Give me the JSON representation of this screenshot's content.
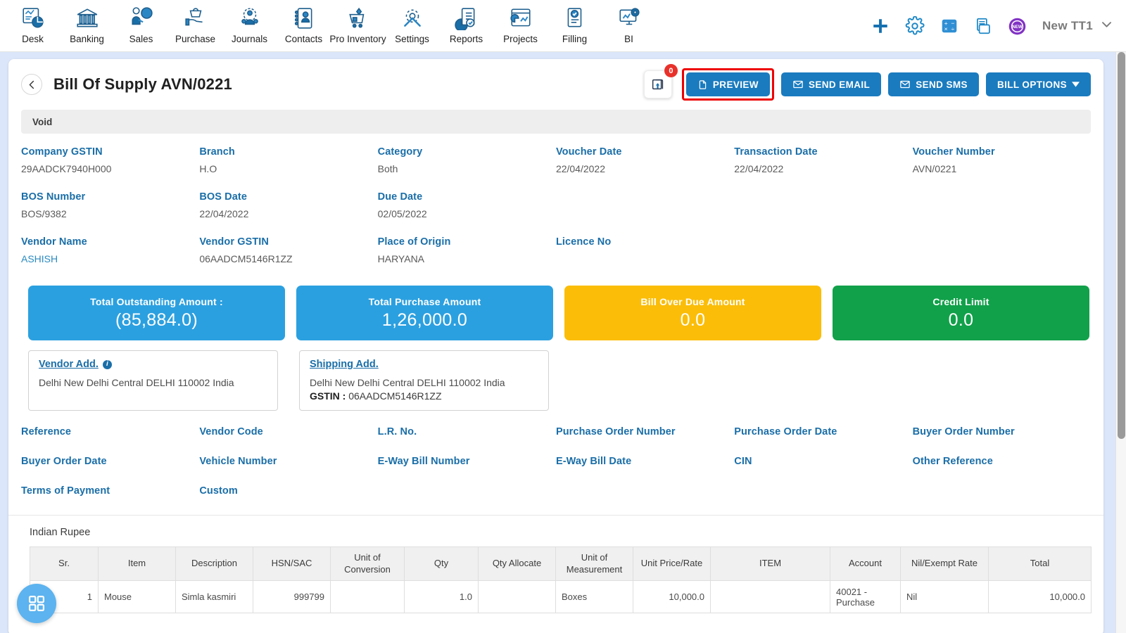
{
  "topnav": {
    "items": [
      {
        "label": "Desk",
        "icon": "dashboard-icon"
      },
      {
        "label": "Banking",
        "icon": "bank-icon"
      },
      {
        "label": "Sales",
        "icon": "sales-icon"
      },
      {
        "label": "Purchase",
        "icon": "purchase-icon"
      },
      {
        "label": "Journals",
        "icon": "journals-icon"
      },
      {
        "label": "Contacts",
        "icon": "contacts-icon"
      },
      {
        "label": "Pro Inventory",
        "icon": "inventory-icon"
      },
      {
        "label": "Settings",
        "icon": "settings-icon"
      },
      {
        "label": "Reports",
        "icon": "reports-icon"
      },
      {
        "label": "Projects",
        "icon": "projects-icon"
      },
      {
        "label": "Filling",
        "icon": "filling-icon"
      },
      {
        "label": "BI",
        "icon": "bi-icon"
      }
    ],
    "right_icons": [
      {
        "name": "add-icon"
      },
      {
        "name": "gear-icon"
      },
      {
        "name": "calculator-icon"
      },
      {
        "name": "notes-icon"
      },
      {
        "name": "new-badge-icon",
        "text": "NEW"
      }
    ],
    "user": {
      "name": "New TT1",
      "caret": "chevron-down-icon"
    }
  },
  "header": {
    "back": "back-arrow-icon",
    "title": "Bill Of Supply AVN/0221",
    "upload": {
      "icon": "upload-attachment-icon",
      "badge": "0"
    },
    "buttons": [
      {
        "label": "PREVIEW",
        "icon": "pdf-icon",
        "highlighted": true
      },
      {
        "label": "SEND EMAIL",
        "icon": "envelope-icon",
        "highlighted": false
      },
      {
        "label": "SEND SMS",
        "icon": "envelope-icon",
        "highlighted": false
      },
      {
        "label": "BILL OPTIONS",
        "icon": "caret-down-icon",
        "highlighted": false
      }
    ]
  },
  "status_bar": {
    "text": "Void"
  },
  "fields": {
    "row1_labels": [
      "Company GSTIN",
      "Branch",
      "Category",
      "Voucher Date",
      "Transaction Date",
      "Voucher Number"
    ],
    "row1_values": [
      "29AADCK7940H000",
      "H.O",
      "Both",
      "22/04/2022",
      "22/04/2022",
      "AVN/0221"
    ],
    "row2_labels": [
      "BOS Number",
      "BOS Date",
      "Due Date",
      "",
      "",
      ""
    ],
    "row2_values": [
      "BOS/9382",
      "22/04/2022",
      "02/05/2022",
      "",
      "",
      ""
    ],
    "row3_labels": [
      "Vendor Name",
      "Vendor GSTIN",
      "Place of Origin",
      "Licence No",
      "",
      ""
    ],
    "row3_values": [
      "ASHISH",
      "06AADCM5146R1ZZ",
      "HARYANA",
      "",
      "",
      ""
    ],
    "row4_labels": [
      "Reference",
      "Vendor Code",
      "L.R. No.",
      "Purchase Order Number",
      "Purchase Order Date",
      "Buyer Order Number"
    ],
    "row5_labels": [
      "Buyer Order Date",
      "Vehicle Number",
      "E-Way Bill Number",
      "E-Way Bill Date",
      "CIN",
      "Other Reference"
    ],
    "row6_labels": [
      "Terms of Payment",
      "Custom",
      "",
      "",
      "",
      ""
    ]
  },
  "stats": [
    {
      "title": "Total Outstanding Amount :",
      "value": "(85,884.0)",
      "color": "#2ba0e0"
    },
    {
      "title": "Total Purchase Amount",
      "value": "1,26,000.0",
      "color": "#2ba0e0"
    },
    {
      "title": "Bill Over Due Amount",
      "value": "0.0",
      "color": "#fbbd08"
    },
    {
      "title": "Credit Limit",
      "value": "0.0",
      "color": "#11a14a"
    }
  ],
  "addresses": {
    "vendor": {
      "title": "Vendor Add.",
      "info_icon": "info-icon",
      "line": "Delhi New Delhi Central DELHI 110002 India"
    },
    "shipping": {
      "title": "Shipping Add.",
      "line": "Delhi New Delhi Central DELHI 110002 India",
      "gstin_label": "GSTIN :",
      "gstin_value": "06AADCM5146R1ZZ"
    }
  },
  "items_table": {
    "currency": "Indian Rupee",
    "columns": [
      "Sr.",
      "Item",
      "Description",
      "HSN/SAC",
      "Unit of Conversion",
      "Qty",
      "Qty Allocate",
      "Unit of Measurement",
      "Unit Price/Rate",
      "ITEM",
      "Account",
      "Nil/Exempt Rate",
      "Total"
    ],
    "rows": [
      {
        "sr": "1",
        "item": "Mouse",
        "description": "Simla kasmiri",
        "hsn_sac": "999799",
        "unit_of_conversion": "",
        "qty": "1.0",
        "qty_allocate": "",
        "unit_of_measurement": "Boxes",
        "unit_price_rate": "10,000.0",
        "item_col": "",
        "account": "40021 - Purchase",
        "nil_exempt_rate": "Nil",
        "total": "10,000.0"
      }
    ]
  },
  "fab": {
    "icon": "apps-grid-icon"
  },
  "colors": {
    "page_background": "#dbe6fa",
    "primary_button": "#1a7bbf",
    "label_blue": "#1a6ea8",
    "link_blue": "#2a8ac0",
    "highlight_red": "#ee0000",
    "badge_red": "#e8312a"
  }
}
